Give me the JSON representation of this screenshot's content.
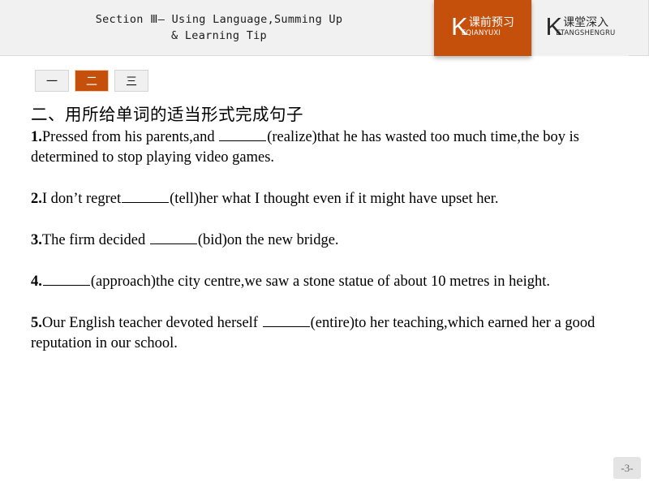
{
  "header": {
    "title": "Section Ⅲ— Using Language,Summing Up\n& Learning Tip",
    "tabs": [
      {
        "initial": "K",
        "chinese": "课前预习",
        "pinyin": "EQIANYUXI",
        "active": true
      },
      {
        "initial": "K",
        "chinese": "课堂深入",
        "pinyin": "ETANGSHENGRU",
        "active": false
      }
    ]
  },
  "nav_buttons": [
    {
      "label": "一",
      "active": false
    },
    {
      "label": "二",
      "active": true
    },
    {
      "label": "三",
      "active": false
    }
  ],
  "main": {
    "section_heading": "二、用所给单词的适当形式完成句子",
    "questions": [
      {
        "number": "1.",
        "text_before": "Pressed from his parents,and ",
        "text_after": "(realize)that he has wasted too much time,the boy is determined to stop playing video games."
      },
      {
        "number": "2.",
        "text_before": "I don’t regret",
        "text_after": "(tell)her what I thought even if it might have upset her."
      },
      {
        "number": "3.",
        "text_before": "The firm decided ",
        "text_after": "(bid)on the new bridge."
      },
      {
        "number": "4.",
        "text_before": "",
        "text_after": "(approach)the city centre,we saw a stone statue of about 10 metres in height."
      },
      {
        "number": "5.",
        "text_before": "Our English teacher devoted herself ",
        "text_after": "(entire)to her teaching,which earned her a good reputation in our school."
      }
    ]
  },
  "footer": {
    "page_label": "-3-"
  },
  "colors": {
    "accent_orange": "#c4500b",
    "header_bg": "#f1f1f1",
    "badge_bg": "#e4e4e4"
  }
}
